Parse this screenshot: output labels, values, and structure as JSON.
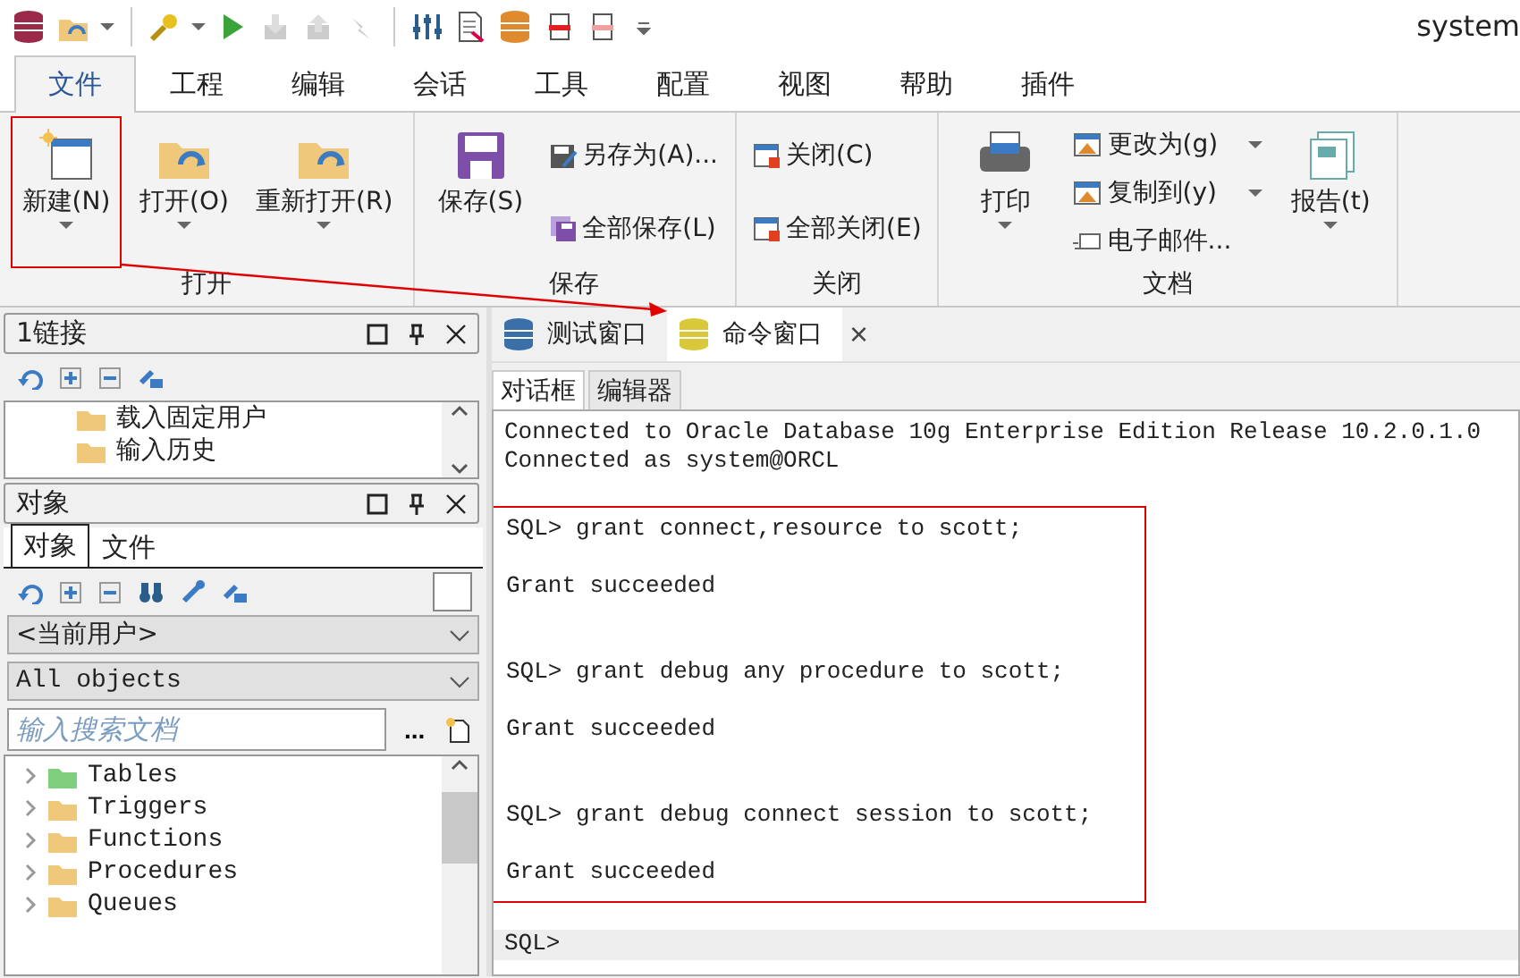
{
  "window": {
    "title": "system"
  },
  "menu_tabs": [
    {
      "label": "文件",
      "selected": true
    },
    {
      "label": "工程",
      "selected": false
    },
    {
      "label": "编辑",
      "selected": false
    },
    {
      "label": "会话",
      "selected": false
    },
    {
      "label": "工具",
      "selected": false
    },
    {
      "label": "配置",
      "selected": false
    },
    {
      "label": "视图",
      "selected": false
    },
    {
      "label": "帮助",
      "selected": false
    },
    {
      "label": "插件",
      "selected": false
    }
  ],
  "ribbon": {
    "groups": [
      {
        "label": "打开",
        "items": [
          {
            "kind": "large",
            "label": "新建(N)",
            "dropdown": true,
            "highlighted": true
          },
          {
            "kind": "large",
            "label": "打开(O)",
            "dropdown": true,
            "highlighted": false
          },
          {
            "kind": "large",
            "label": "重新打开(R)",
            "dropdown": true,
            "highlighted": false
          }
        ]
      },
      {
        "label": "保存",
        "items": [
          {
            "kind": "large",
            "label": "保存(S)",
            "dropdown": false,
            "highlighted": false
          },
          {
            "kind": "small",
            "label": "另存为(A)...",
            "dropdown": false,
            "highlighted": false
          },
          {
            "kind": "small",
            "label": "全部保存(L)",
            "dropdown": false,
            "highlighted": false
          }
        ]
      },
      {
        "label": "关闭",
        "items": [
          {
            "kind": "small",
            "label": "关闭(C)",
            "dropdown": false,
            "highlighted": false
          },
          {
            "kind": "small",
            "label": "全部关闭(E)",
            "dropdown": false,
            "highlighted": false
          }
        ]
      },
      {
        "label": "文档",
        "items": [
          {
            "kind": "large",
            "label": "打印",
            "dropdown": true,
            "highlighted": false
          },
          {
            "kind": "small",
            "label": "更改为(g)",
            "dropdown": true,
            "highlighted": false
          },
          {
            "kind": "small",
            "label": "复制到(y)",
            "dropdown": true,
            "highlighted": false
          },
          {
            "kind": "small",
            "label": "电子邮件...",
            "dropdown": false,
            "highlighted": false
          },
          {
            "kind": "large",
            "label": "报告(t)",
            "dropdown": true,
            "highlighted": false
          }
        ]
      }
    ]
  },
  "annotation_arrow": true,
  "connections_panel": {
    "title": "1链接",
    "items": [
      "载入固定用户",
      "输入历史"
    ]
  },
  "objects_panel": {
    "title": "对象",
    "tabs": [
      {
        "label": "对象",
        "selected": true
      },
      {
        "label": "文件",
        "selected": false
      }
    ],
    "owner": "<当前用户>",
    "filter": "All objects",
    "search": {
      "placeholder": "输入搜索文档"
    },
    "more": "...",
    "tree": [
      {
        "label": "Tables",
        "color": "#7fcf7f"
      },
      {
        "label": "Triggers",
        "color": "#f0c87c"
      },
      {
        "label": "Functions",
        "color": "#f0c87c"
      },
      {
        "label": "Procedures",
        "color": "#f0c87c"
      },
      {
        "label": "Queues",
        "color": "#f0c87c"
      }
    ]
  },
  "doc_tabs": [
    {
      "label": "测试窗口",
      "selected": false,
      "highlighted": false,
      "closable": false
    },
    {
      "label": "命令窗口",
      "selected": true,
      "highlighted": true,
      "closable": true
    }
  ],
  "close_glyph": "×",
  "sub_tabs": [
    {
      "label": "对话框",
      "selected": true
    },
    {
      "label": "编辑器",
      "selected": false
    }
  ],
  "console": {
    "header": [
      "Connected to Oracle Database 10g Enterprise Edition Release 10.2.0.1.0",
      "Connected as system@ORCL"
    ],
    "block": {
      "outlined": true,
      "entries": [
        {
          "command": "SQL> grant connect,resource to scott;",
          "result": "Grant succeeded"
        },
        {
          "command": "SQL> grant debug any procedure to scott;",
          "result": "Grant succeeded"
        },
        {
          "command": "SQL> grant debug connect session to scott;",
          "result": "Grant succeeded"
        }
      ]
    },
    "prompt": "SQL>"
  }
}
